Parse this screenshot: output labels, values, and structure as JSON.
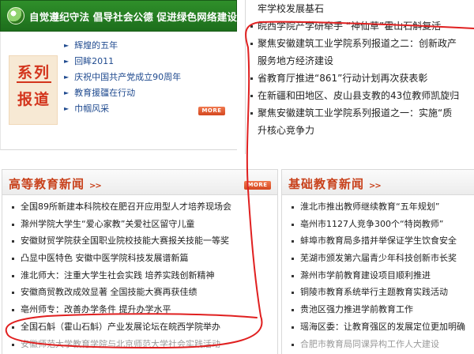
{
  "banner": {
    "slogan": "自觉遵纪守法 倡导社会公德 促进绿色网络建设",
    "icon": "globe-icon"
  },
  "series": {
    "badge_line1": "系列",
    "badge_line2": "报道",
    "items": [
      {
        "label": "辉煌的五年"
      },
      {
        "label": "回眸2011"
      },
      {
        "label": "庆祝中国共产党成立90周年"
      },
      {
        "label": "教育援疆在行动"
      },
      {
        "label": "巾帼风采"
      }
    ],
    "more_label": "MORE"
  },
  "right_news": [
    {
      "text": "牢学校发展基石",
      "bullet": false
    },
    {
      "text": "皖西学院产学研牵手 “神仙草”霍山石斛复活",
      "bullet": true
    },
    {
      "text": "聚焦安徽建筑工业学院系列报道之二：创新政产",
      "bullet": true
    },
    {
      "text": "服务地方经济建设",
      "bullet": false
    },
    {
      "text": "省教育厅推进“861”行动计划再次获表彰",
      "bullet": true
    },
    {
      "text": "在新疆和田地区、皮山县支教的43位教师凯旋归",
      "bullet": true
    },
    {
      "text": "聚焦安徽建筑工业学院系列报道之一：实施“质",
      "bullet": true
    },
    {
      "text": "升核心竞争力",
      "bullet": false
    }
  ],
  "higher_ed": {
    "title": "高等教育新闻",
    "chevron": ">>",
    "more_label": "MORE",
    "items": [
      {
        "text": "全国89所新建本科院校在肥召开应用型人才培养现场会"
      },
      {
        "text": "滁州学院大学生“爱心家教”关爱社区留守儿童"
      },
      {
        "text": "安徽财贸学院获全国职业院校技能大赛报关技能一等奖"
      },
      {
        "text": "凸显中医特色 安徽中医学院科技发展谱新篇"
      },
      {
        "text": "淮北师大：注重大学生社会实践 培养实践创新精神"
      },
      {
        "text": "安徽商贸教改成效显著 全国技能大赛再获佳绩"
      },
      {
        "text": "亳州师专：改善办学条件 提升办学水平"
      },
      {
        "text": "全国石斛（霍山石斛）产业发展论坛在皖西学院举办"
      },
      {
        "text": "安徽师范大学教育学院与北京师范大学社会实践活动"
      }
    ]
  },
  "basic_ed": {
    "title": "基础教育新闻",
    "chevron": ">>",
    "items": [
      {
        "text": "淮北市推出教师继续教育“五年规划”"
      },
      {
        "text": "亳州市1127人竞争300个“特岗教师”"
      },
      {
        "text": "蚌埠市教育局多措并举保证学生饮食安全"
      },
      {
        "text": "芜湖市颁发第六届青少年科技创新市长奖"
      },
      {
        "text": "滁州市学前教育建设项目顺利推进"
      },
      {
        "text": "铜陵市教育系统举行主题教育实践活动"
      },
      {
        "text": "贵池区强力推进学前教育工作"
      },
      {
        "text": "瑶海区委：让教育强区的发展定位更加明确"
      },
      {
        "text": "合肥市教育局同课异构工作人大建设"
      }
    ]
  },
  "colors": {
    "banner_green": "#1d6e1c",
    "section_title": "#c8411b",
    "link_blue": "#1f4a8f",
    "annotation_red": "#e02020"
  }
}
